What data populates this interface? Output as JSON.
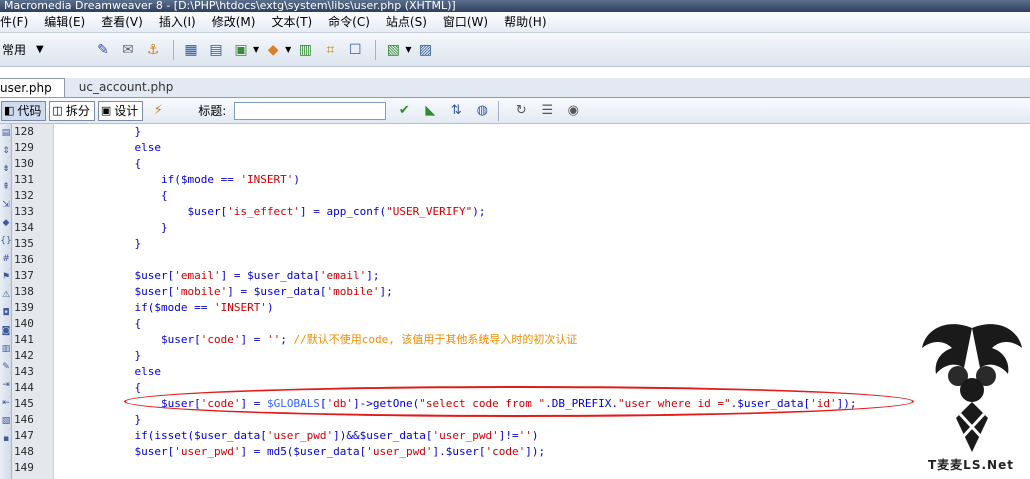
{
  "window": {
    "title": "Macromedia Dreamweaver 8 - [D:\\PHP\\htdocs\\extg\\system\\libs\\user.php (XHTML)]"
  },
  "menu": [
    "件(F)",
    "编辑(E)",
    "查看(V)",
    "插入(I)",
    "修改(M)",
    "文本(T)",
    "命令(C)",
    "站点(S)",
    "窗口(W)",
    "帮助(H)"
  ],
  "insert_bar": {
    "category": "常用"
  },
  "tabs": [
    "user.php",
    "uc_account.php"
  ],
  "doc_toolbar": {
    "code": "代码",
    "split": "拆分",
    "design": "设计",
    "title_label": "标题:",
    "title_value": ""
  },
  "line_numbers": [
    "128",
    "129",
    "130",
    "131",
    "132",
    "133",
    "134",
    "135",
    "136",
    "137",
    "138",
    "139",
    "140",
    "141",
    "142",
    "143",
    "144",
    "145",
    "146",
    "147",
    "148",
    "149"
  ],
  "code": {
    "l128": "            }",
    "l129": "            else",
    "l130": "            {",
    "l131a": "                if($mode == ",
    "l131b": "'INSERT'",
    "l131c": ")",
    "l132": "                {",
    "l133a": "                    $user[",
    "l133b": "'is_effect'",
    "l133c": "] = app_conf(",
    "l133d": "\"USER_VERIFY\"",
    "l133e": ");",
    "l134": "                }",
    "l135": "            }",
    "l136": "",
    "l137a": "            $user[",
    "l137b": "'email'",
    "l137c": "] = $user_data[",
    "l137d": "'email'",
    "l137e": "];",
    "l138a": "            $user[",
    "l138b": "'mobile'",
    "l138c": "] = $user_data[",
    "l138d": "'mobile'",
    "l138e": "];",
    "l139a": "            if($mode == ",
    "l139b": "'INSERT'",
    "l139c": ")",
    "l140": "            {",
    "l141a": "                $user[",
    "l141b": "'code'",
    "l141c": "] = ",
    "l141d": "''",
    "l141e": "; ",
    "l141f": "//默认不使用code, 该值用于其他系统导入时的初次认证",
    "l142": "            }",
    "l143": "            else",
    "l144": "            {",
    "l145a": "                $user[",
    "l145b": "'code'",
    "l145c": "] = ",
    "l145d": "$GLOBALS",
    "l145e": "[",
    "l145f": "'db'",
    "l145g": "]->getOne(",
    "l145h": "\"select code from \"",
    "l145i": ".DB_PREFIX.",
    "l145j": "\"user where id =\"",
    "l145k": ".$user_data[",
    "l145l": "'id'",
    "l145m": "]);",
    "l146": "            }",
    "l147a": "            if(isset($user_data[",
    "l147b": "'user_pwd'",
    "l147c": "])&&$user_data[",
    "l147d": "'user_pwd'",
    "l147e": "]!=",
    "l147f": "''",
    "l147g": ")",
    "l148a": "            $user[",
    "l148b": "'user_pwd'",
    "l148c": "] = md5($user_data[",
    "l148d": "'user_pwd'",
    "l148e": "].$user[",
    "l148f": "'code'",
    "l148g": "]);",
    "l149": ""
  },
  "watermark": {
    "text": "T麦麦LS.Net"
  },
  "colors": {
    "keyword": "#0000cc",
    "string": "#cc0000",
    "comment": "#f08c00",
    "global": "#3366ff",
    "highlight_ellipse": "#e31a1a"
  }
}
